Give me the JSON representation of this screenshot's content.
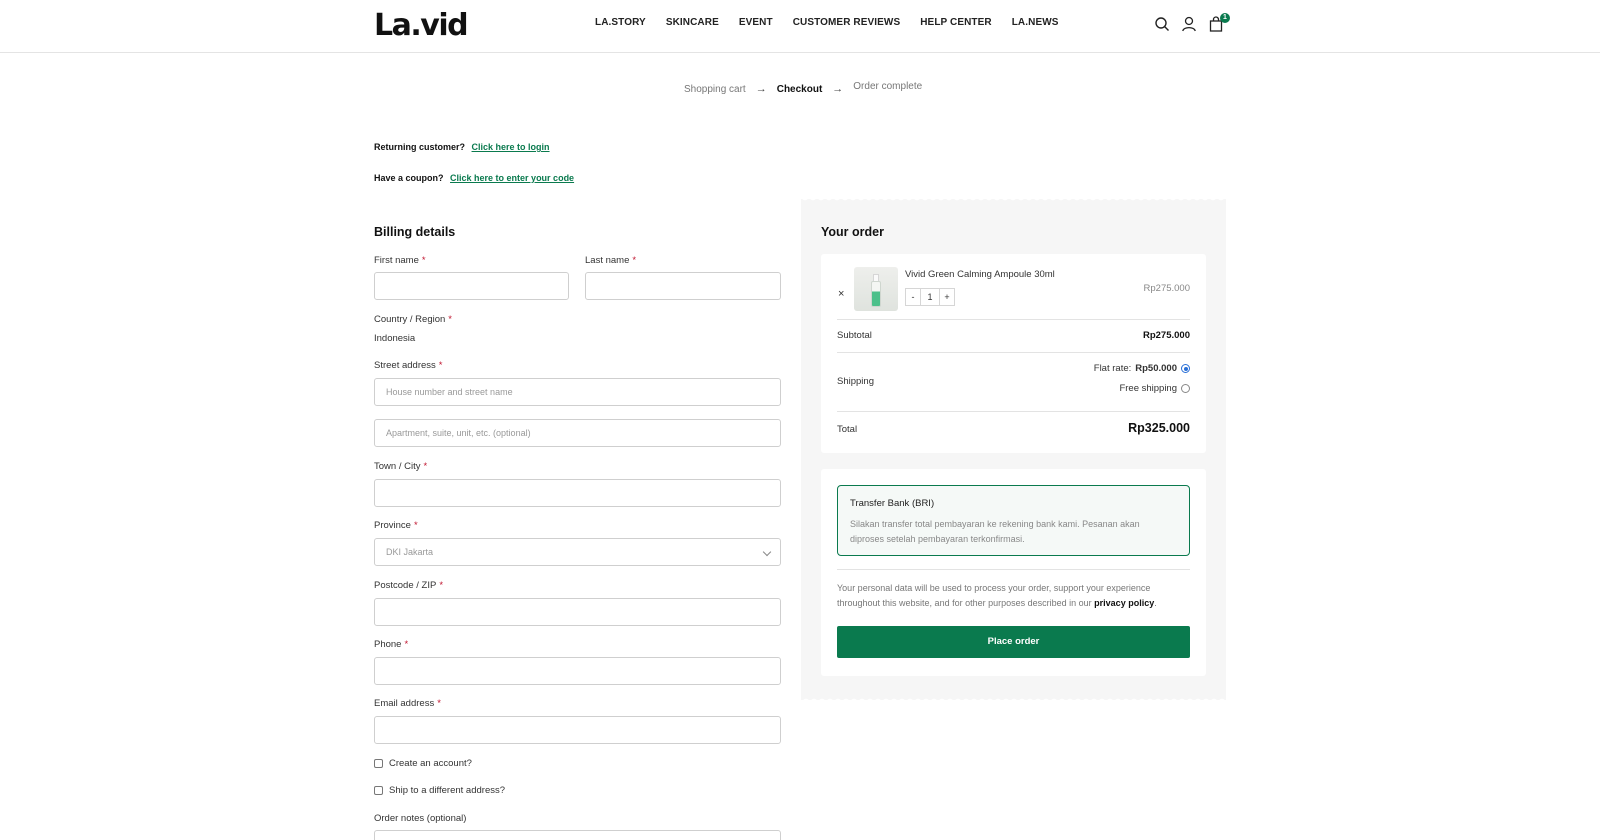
{
  "header": {
    "logo": "La.vid",
    "nav": [
      "LA.STORY",
      "SKINCARE",
      "EVENT",
      "CUSTOMER REVIEWS",
      "HELP CENTER",
      "LA.NEWS"
    ],
    "cart_count": "1",
    "icons": [
      "search-icon",
      "user-icon",
      "cart-icon"
    ]
  },
  "steps": {
    "cart": "Shopping cart",
    "checkout": "Checkout",
    "complete": "Order complete",
    "arrow": "→"
  },
  "notices": {
    "returning_text": "Returning customer?",
    "returning_link": "Click here to login",
    "coupon_text": "Have a coupon?",
    "coupon_link": "Click here to enter your code"
  },
  "billing": {
    "title": "Billing details",
    "required_mark": "*",
    "first_name_label": "First name",
    "last_name_label": "Last name",
    "country_label": "Country / Region",
    "country_value": "Indonesia",
    "street_label": "Street address",
    "street_placeholder": "House number and street name",
    "apt_placeholder": "Apartment, suite, unit, etc. (optional)",
    "city_label": "Town / City",
    "province_label": "Province",
    "province_value": "DKI Jakarta",
    "postcode_label": "Postcode / ZIP",
    "phone_label": "Phone",
    "email_label": "Email address",
    "create_account": "Create an account?",
    "ship_different": "Ship to a different address?",
    "notes_label": "Order notes (optional)"
  },
  "order": {
    "title": "Your order",
    "remove": "×",
    "product_name": "Vivid Green Calming Ampoule 30ml",
    "qty_minus": "-",
    "qty_value": "1",
    "qty_plus": "+",
    "product_price": "Rp275.000",
    "subtotal_label": "Subtotal",
    "subtotal_value": "Rp275.000",
    "shipping_label": "Shipping",
    "flat_rate_label": "Flat rate:",
    "flat_rate_value": "Rp50.000",
    "free_shipping_label": "Free shipping",
    "total_label": "Total",
    "total_value": "Rp325.000"
  },
  "payment": {
    "method_title": "Transfer Bank (BRI)",
    "method_desc": "Silakan transfer total pembayaran ke rekening bank kami. Pesanan akan diproses setelah pembayaran terkonfirmasi.",
    "privacy_text": "Your personal data will be used to process your order, support your experience throughout this website, and for other purposes described in our",
    "privacy_link": "privacy policy",
    "privacy_end": ".",
    "place_order": "Place order"
  },
  "colors": {
    "accent": "#0a7a4e",
    "required": "#c0152f",
    "radio_selected": "#2a6fd6"
  }
}
